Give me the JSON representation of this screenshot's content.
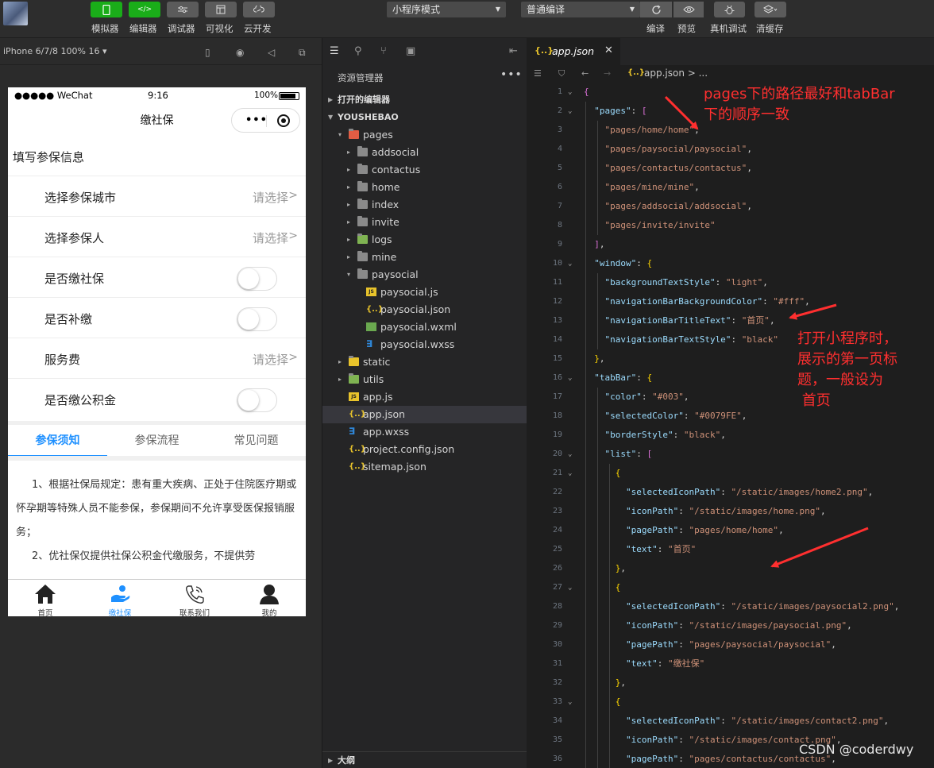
{
  "toolbar": {
    "buttons": [
      {
        "icon": "phone-icon",
        "label": "模拟器"
      },
      {
        "icon": "code-icon",
        "label": "编辑器",
        "glyph": "</>"
      },
      {
        "icon": "sliders-icon",
        "label": "调试器"
      },
      {
        "icon": "layout-icon",
        "label": "可视化"
      },
      {
        "icon": "cloud-link-icon",
        "label": "云开发"
      }
    ],
    "mode_select": "小程序模式",
    "compile_select": "普通编译",
    "right_buttons": [
      {
        "icon": "refresh-icon",
        "label": "编译"
      },
      {
        "icon": "eye-icon",
        "label": "预览"
      },
      {
        "icon": "bug-icon",
        "label": "真机调试"
      },
      {
        "icon": "layers-icon",
        "label": "清缓存"
      }
    ]
  },
  "simulator": {
    "device": "iPhone 6/7/8 100% 16 ▾",
    "status": {
      "carrier": "●●●●● WeChat",
      "time": "9:16",
      "battery": "100%"
    },
    "nav_title": "缴社保",
    "section_title": "填写参保信息",
    "rows": [
      {
        "label": "选择参保城市",
        "value": "请选择",
        "arrow": ">",
        "type": "picker"
      },
      {
        "label": "选择参保人",
        "value": "请选择",
        "arrow": ">",
        "type": "picker"
      },
      {
        "label": "是否缴社保",
        "type": "switch",
        "checked": false
      },
      {
        "label": "是否补缴",
        "type": "switch",
        "checked": false
      },
      {
        "label": "服务费",
        "value": "请选择",
        "arrow": ">",
        "type": "picker"
      },
      {
        "label": "是否缴公积金",
        "type": "switch",
        "checked": false
      }
    ],
    "tabs": [
      "参保须知",
      "参保流程",
      "常见问题"
    ],
    "tips": [
      "1、根据社保局规定：患有重大疾病、正处于住院医疗期或怀孕期等特殊人员不能参保，参保期间不允许享受医保报销服务；",
      "2、优社保仅提供社保公积金代缴服务，不提供劳"
    ],
    "tabbar": [
      {
        "label": "首页",
        "icon": "home-icon"
      },
      {
        "label": "缴社保",
        "icon": "hand-icon"
      },
      {
        "label": "联系我们",
        "icon": "phone-call-icon"
      },
      {
        "label": "我的",
        "icon": "user-icon"
      }
    ]
  },
  "explorer": {
    "title": "资源管理器",
    "more": "•••",
    "open_editors": "打开的编辑器",
    "project": "YOUSHEBAO",
    "tree": [
      {
        "name": "pages",
        "depth": 1,
        "kind": "folder-open",
        "twisty": "▾"
      },
      {
        "name": "addsocial",
        "depth": 2,
        "kind": "folder",
        "twisty": "▸"
      },
      {
        "name": "contactus",
        "depth": 2,
        "kind": "folder",
        "twisty": "▸"
      },
      {
        "name": "home",
        "depth": 2,
        "kind": "folder",
        "twisty": "▸"
      },
      {
        "name": "index",
        "depth": 2,
        "kind": "folder",
        "twisty": "▸"
      },
      {
        "name": "invite",
        "depth": 2,
        "kind": "folder",
        "twisty": "▸"
      },
      {
        "name": "logs",
        "depth": 2,
        "kind": "folder",
        "twisty": "▸"
      },
      {
        "name": "mine",
        "depth": 2,
        "kind": "folder",
        "twisty": "▸"
      },
      {
        "name": "paysocial",
        "depth": 2,
        "kind": "folder-open",
        "twisty": "▾"
      },
      {
        "name": "paysocial.js",
        "depth": 3,
        "kind": "js"
      },
      {
        "name": "paysocial.json",
        "depth": 3,
        "kind": "json"
      },
      {
        "name": "paysocial.wxml",
        "depth": 3,
        "kind": "wxml"
      },
      {
        "name": "paysocial.wxss",
        "depth": 3,
        "kind": "wxss"
      },
      {
        "name": "static",
        "depth": 1,
        "kind": "folder",
        "twisty": "▸"
      },
      {
        "name": "utils",
        "depth": 1,
        "kind": "folder",
        "twisty": "▸"
      },
      {
        "name": "app.js",
        "depth": 1,
        "kind": "js"
      },
      {
        "name": "app.json",
        "depth": 1,
        "kind": "json",
        "selected": true
      },
      {
        "name": "app.wxss",
        "depth": 1,
        "kind": "wxss"
      },
      {
        "name": "project.config.json",
        "depth": 1,
        "kind": "json"
      },
      {
        "name": "sitemap.json",
        "depth": 1,
        "kind": "json"
      }
    ],
    "outline": "大纲"
  },
  "editor": {
    "tab_name": "app.json",
    "tab_close": "✕",
    "json_glyph": "{..}",
    "breadcrumb": "app.json > ...",
    "lines": [
      {
        "n": 1,
        "fold": "⌄",
        "t": [
          [
            "b",
            "{"
          ]
        ]
      },
      {
        "n": 2,
        "fold": "⌄",
        "t": [
          [
            "k",
            "  \"pages\""
          ],
          [
            "p",
            ": "
          ],
          [
            "b",
            "["
          ]
        ]
      },
      {
        "n": 3,
        "t": [
          [
            "s",
            "    \"pages/home/home\""
          ],
          [
            "p",
            ","
          ]
        ]
      },
      {
        "n": 4,
        "t": [
          [
            "s",
            "    \"pages/paysocial/paysocial\""
          ],
          [
            "p",
            ","
          ]
        ]
      },
      {
        "n": 5,
        "t": [
          [
            "s",
            "    \"pages/contactus/contactus\""
          ],
          [
            "p",
            ","
          ]
        ]
      },
      {
        "n": 6,
        "t": [
          [
            "s",
            "    \"pages/mine/mine\""
          ],
          [
            "p",
            ","
          ]
        ]
      },
      {
        "n": 7,
        "t": [
          [
            "s",
            "    \"pages/addsocial/addsocial\""
          ],
          [
            "p",
            ","
          ]
        ]
      },
      {
        "n": 8,
        "t": [
          [
            "s",
            "    \"pages/invite/invite\""
          ]
        ]
      },
      {
        "n": 9,
        "t": [
          [
            "b",
            "  ]"
          ],
          [
            "p",
            ","
          ]
        ]
      },
      {
        "n": 10,
        "fold": "⌄",
        "t": [
          [
            "k",
            "  \"window\""
          ],
          [
            "p",
            ": "
          ],
          [
            "y",
            "{"
          ]
        ]
      },
      {
        "n": 11,
        "t": [
          [
            "k",
            "    \"backgroundTextStyle\""
          ],
          [
            "p",
            ": "
          ],
          [
            "s",
            "\"light\""
          ],
          [
            "p",
            ","
          ]
        ]
      },
      {
        "n": 12,
        "t": [
          [
            "k",
            "    \"navigationBarBackgroundColor\""
          ],
          [
            "p",
            ": "
          ],
          [
            "s",
            "\"#fff\""
          ],
          [
            "p",
            ","
          ]
        ]
      },
      {
        "n": 13,
        "t": [
          [
            "k",
            "    \"navigationBarTitleText\""
          ],
          [
            "p",
            ": "
          ],
          [
            "s",
            "\"首页\""
          ],
          [
            "p",
            ","
          ]
        ]
      },
      {
        "n": 14,
        "t": [
          [
            "k",
            "    \"navigationBarTextStyle\""
          ],
          [
            "p",
            ": "
          ],
          [
            "s",
            "\"black\""
          ]
        ]
      },
      {
        "n": 15,
        "t": [
          [
            "y",
            "  }"
          ],
          [
            "p",
            ","
          ]
        ]
      },
      {
        "n": 16,
        "fold": "⌄",
        "t": [
          [
            "k",
            "  \"tabBar\""
          ],
          [
            "p",
            ": "
          ],
          [
            "y",
            "{"
          ]
        ]
      },
      {
        "n": 17,
        "t": [
          [
            "k",
            "    \"color\""
          ],
          [
            "p",
            ": "
          ],
          [
            "s",
            "\"#003\""
          ],
          [
            "p",
            ","
          ]
        ]
      },
      {
        "n": 18,
        "t": [
          [
            "k",
            "    \"selectedColor\""
          ],
          [
            "p",
            ": "
          ],
          [
            "s",
            "\"#0079FE\""
          ],
          [
            "p",
            ","
          ]
        ]
      },
      {
        "n": 19,
        "t": [
          [
            "k",
            "    \"borderStyle\""
          ],
          [
            "p",
            ": "
          ],
          [
            "s",
            "\"black\""
          ],
          [
            "p",
            ","
          ]
        ]
      },
      {
        "n": 20,
        "fold": "⌄",
        "t": [
          [
            "k",
            "    \"list\""
          ],
          [
            "p",
            ": "
          ],
          [
            "b",
            "["
          ]
        ]
      },
      {
        "n": 21,
        "fold": "⌄",
        "t": [
          [
            "y",
            "      {"
          ]
        ]
      },
      {
        "n": 22,
        "t": [
          [
            "k",
            "        \"selectedIconPath\""
          ],
          [
            "p",
            ": "
          ],
          [
            "s",
            "\"/static/images/home2.png\""
          ],
          [
            "p",
            ","
          ]
        ]
      },
      {
        "n": 23,
        "t": [
          [
            "k",
            "        \"iconPath\""
          ],
          [
            "p",
            ": "
          ],
          [
            "s",
            "\"/static/images/home.png\""
          ],
          [
            "p",
            ","
          ]
        ]
      },
      {
        "n": 24,
        "t": [
          [
            "k",
            "        \"pagePath\""
          ],
          [
            "p",
            ": "
          ],
          [
            "s",
            "\"pages/home/home\""
          ],
          [
            "p",
            ","
          ]
        ]
      },
      {
        "n": 25,
        "t": [
          [
            "k",
            "        \"text\""
          ],
          [
            "p",
            ": "
          ],
          [
            "s",
            "\"首页\""
          ]
        ]
      },
      {
        "n": 26,
        "t": [
          [
            "y",
            "      }"
          ],
          [
            "p",
            ","
          ]
        ]
      },
      {
        "n": 27,
        "fold": "⌄",
        "t": [
          [
            "y",
            "      {"
          ]
        ]
      },
      {
        "n": 28,
        "t": [
          [
            "k",
            "        \"selectedIconPath\""
          ],
          [
            "p",
            ": "
          ],
          [
            "s",
            "\"/static/images/paysocial2.png\""
          ],
          [
            "p",
            ","
          ]
        ]
      },
      {
        "n": 29,
        "t": [
          [
            "k",
            "        \"iconPath\""
          ],
          [
            "p",
            ": "
          ],
          [
            "s",
            "\"/static/images/paysocial.png\""
          ],
          [
            "p",
            ","
          ]
        ]
      },
      {
        "n": 30,
        "t": [
          [
            "k",
            "        \"pagePath\""
          ],
          [
            "p",
            ": "
          ],
          [
            "s",
            "\"pages/paysocial/paysocial\""
          ],
          [
            "p",
            ","
          ]
        ]
      },
      {
        "n": 31,
        "t": [
          [
            "k",
            "        \"text\""
          ],
          [
            "p",
            ": "
          ],
          [
            "s",
            "\"缴社保\""
          ]
        ]
      },
      {
        "n": 32,
        "t": [
          [
            "y",
            "      }"
          ],
          [
            "p",
            ","
          ]
        ]
      },
      {
        "n": 33,
        "fold": "⌄",
        "t": [
          [
            "y",
            "      {"
          ]
        ]
      },
      {
        "n": 34,
        "t": [
          [
            "k",
            "        \"selectedIconPath\""
          ],
          [
            "p",
            ": "
          ],
          [
            "s",
            "\"/static/images/contact2.png\""
          ],
          [
            "p",
            ","
          ]
        ]
      },
      {
        "n": 35,
        "t": [
          [
            "k",
            "        \"iconPath\""
          ],
          [
            "p",
            ": "
          ],
          [
            "s",
            "\"/static/images/contact.png\""
          ],
          [
            "p",
            ","
          ]
        ]
      },
      {
        "n": 36,
        "t": [
          [
            "k",
            "        \"pagePath\""
          ],
          [
            "p",
            ": "
          ],
          [
            "s",
            "\"pages/contactus/contactus\""
          ],
          [
            "p",
            ","
          ]
        ]
      }
    ]
  },
  "annotations": {
    "pages_note": [
      "pages下的路径最好和tabBar",
      "下的顺序一致"
    ],
    "title_note": [
      "打开小程序时，",
      "展示的第一页标",
      "题，一般设为",
      " 首页"
    ]
  },
  "watermark": "CSDN @coderdwy",
  "colors": {
    "annotation": "#ff2f2f",
    "accent": "#1e90ff",
    "wechat_green": "#1aad19"
  }
}
